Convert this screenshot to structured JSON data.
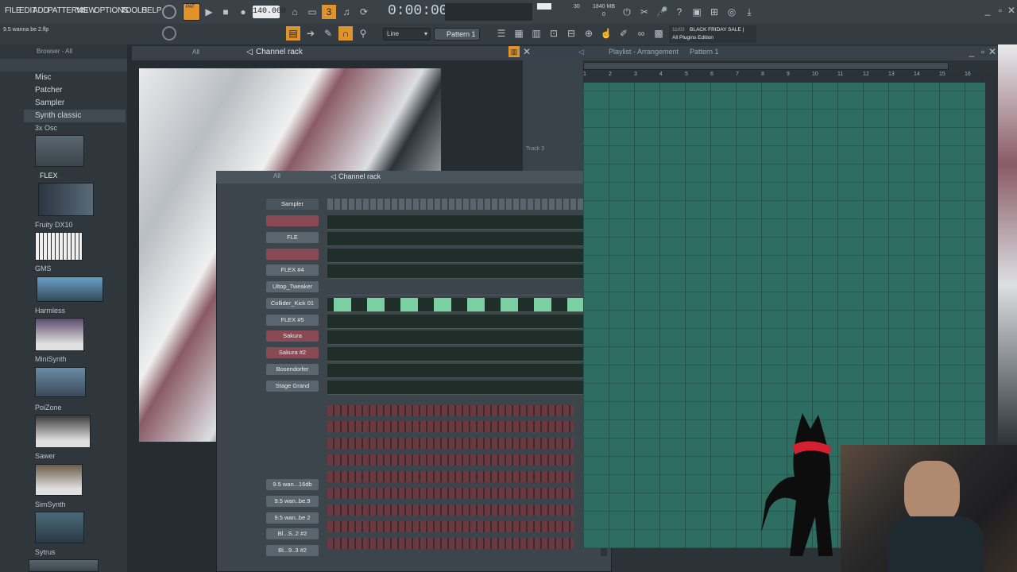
{
  "menu": [
    "FILE",
    "EDIT",
    "ADD",
    "PATTERNS",
    "VIEW",
    "OPTIONS",
    "TOOLS",
    "HELP"
  ],
  "pat_label": "PAT",
  "tempo": "140.000",
  "time": "0:00:00",
  "memory": "1840 MB",
  "cpu_num": "30",
  "cpu_zero": "0",
  "snap": "Line",
  "pattern_name": "Pattern 1",
  "hint": "9.5 wanna be 2.flp",
  "news_date": "11/02",
  "news_line1": "BLACK FRIDAY SALE |",
  "news_line2": "All Plugins Edition",
  "browser": {
    "title": "Browser - All",
    "filter": "All",
    "folders": [
      "Misc",
      "Patcher",
      "Sampler",
      "Synth classic"
    ],
    "plugins": [
      "3x Osc",
      "FLEX",
      "Fruity DX10",
      "GMS",
      "Harmless",
      "MiniSynth",
      "PoiZone",
      "Sawer",
      "SimSynth",
      "Sytrus"
    ]
  },
  "channel_rack": {
    "title": "Channel rack",
    "filter": "All",
    "channels": [
      "Sampler",
      "FLE",
      "FLEX #4",
      "Ultop_Tweaker",
      "Collider_Kick 01",
      "FLEX #5",
      "Sakura",
      "Sakura #2",
      "Bosendorfer",
      "Stage Grand",
      "9.5 wan...16db",
      "9.5 wan..be.9",
      "9.5 wan..be 2",
      "Bl...S..2 #2",
      "Bl...9..3 #2"
    ]
  },
  "playlist": {
    "title": "Playlist - Arrangement",
    "pattern": "Pattern 1",
    "ruler": [
      "1",
      "2",
      "3",
      "4",
      "5",
      "6",
      "7",
      "8",
      "9",
      "10",
      "11",
      "12",
      "13",
      "14",
      "15",
      "16"
    ],
    "track_label": "Track 3"
  },
  "colors": {
    "accent": "#f5a623",
    "playlist": "#2e6d62",
    "red_channel": "#8a4a55"
  }
}
